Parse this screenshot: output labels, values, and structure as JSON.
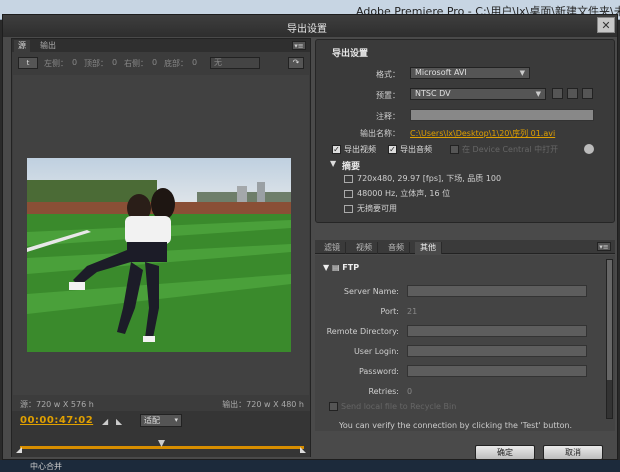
{
  "host": {
    "title": "Adobe Premiere Pro - C:\\用户\\lx\\桌面\\新建文件夹\\未命名"
  },
  "dialog": {
    "title": "导出设置",
    "close": "✕"
  },
  "left": {
    "tabs": [
      "源",
      "输出"
    ],
    "menu": "▾≡",
    "crop": {
      "icon": "t",
      "left_label": "左侧：",
      "left_value": "0",
      "top_label": "顶部：",
      "top_value": "0",
      "right_label": "右侧：",
      "right_value": "0",
      "bottom_label": "底部：",
      "bottom_value": "0",
      "ratio": "无",
      "arrow": "↷"
    },
    "source_info": "源：720 w X 576 h",
    "output_info": "输出：720 w X 480 h",
    "timecode": "00:00:47:02",
    "fit": "适配"
  },
  "export": {
    "heading": "导出设置",
    "format_label": "格式：",
    "format_value": "Microsoft AVI",
    "preset_label": "预置：",
    "preset_value": "NTSC DV",
    "comment_label": "注释：",
    "output_label": "输出名称：",
    "output_value": "C:\\Users\\lx\\Desktop\\1\\20\\序列 01.avi",
    "export_video": "导出视频",
    "export_audio": "导出音频",
    "device_central": "在 Device Central 中打开",
    "summary_title": "摘要",
    "summary": [
      "720x480, 29.97 [fps], 下场, 品质 100",
      "48000 Hz, 立体声, 16 位",
      "无摘要可用"
    ]
  },
  "tabs2": [
    "滤镜",
    "视频",
    "音频",
    "其他"
  ],
  "ftp": {
    "heading": "FTP",
    "server_label": "Server Name:",
    "port_label": "Port:",
    "port_value": "21",
    "dir_label": "Remote Directory:",
    "login_label": "User Login:",
    "password_label": "Password:",
    "retries_label": "Retries:",
    "retries_value": "0",
    "recycle": "Send local file to Recycle Bin",
    "hint": "You can verify the connection by clicking the 'Test' button."
  },
  "buttons": {
    "ok": "确定",
    "cancel": "取消"
  },
  "taskbar": {
    "item": "中心合并"
  },
  "colors": {
    "accent": "#e0a000",
    "timeline": "#d88e00"
  }
}
